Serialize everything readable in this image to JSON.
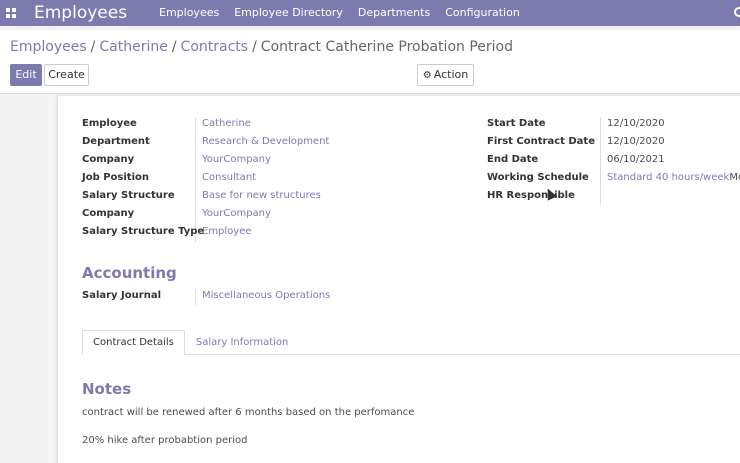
{
  "navbar": {
    "brand": "Employees",
    "menu": [
      "Employees",
      "Employee Directory",
      "Departments",
      "Configuration"
    ]
  },
  "breadcrumb": {
    "items": [
      "Employees",
      "Catherine",
      "Contracts"
    ],
    "active": "Contract Catherine Probation Period",
    "separator": "/"
  },
  "toolbar": {
    "edit_label": "Edit",
    "create_label": "Create",
    "action_label": "Action"
  },
  "form": {
    "left_fields": [
      {
        "label": "Employee",
        "value": "Catherine"
      },
      {
        "label": "Department",
        "value": "Research & Development"
      },
      {
        "label": "Company",
        "value": "YourCompany"
      },
      {
        "label": "Job Position",
        "value": "Consultant"
      },
      {
        "label": "Salary Structure",
        "value": "Base for new structures"
      },
      {
        "label": "Company",
        "value": "YourCompany"
      },
      {
        "label": "Salary Structure Type",
        "value": "Employee"
      }
    ],
    "right_fields": [
      {
        "label": "Start Date",
        "value": "12/10/2020"
      },
      {
        "label": "First Contract Date",
        "value": "12/10/2020"
      },
      {
        "label": "End Date",
        "value": "06/10/2021"
      },
      {
        "label": "Working Schedule",
        "value": "Standard 40 hours/week",
        "extra": "Month"
      },
      {
        "label": "HR Responsible",
        "value": ""
      }
    ]
  },
  "accounting": {
    "title": "Accounting",
    "salary_journal_label": "Salary Journal",
    "salary_journal_value": "Miscellaneous Operations"
  },
  "tabs": [
    "Contract Details",
    "Salary Information"
  ],
  "notes": {
    "title": "Notes",
    "lines": [
      "contract will be renewed after 6 months based on the perfomance",
      "20% hike after probabtion period"
    ]
  },
  "colors": {
    "brand": "#7c7bad",
    "navbar": "#7c7bad"
  }
}
